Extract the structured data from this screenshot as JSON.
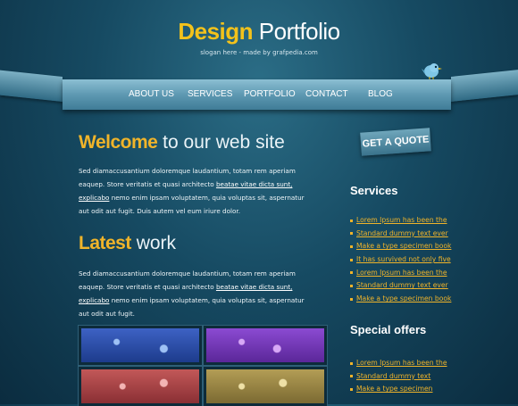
{
  "header": {
    "logo_part1": "Design",
    "logo_part2": "Portfolio",
    "slogan": "slogan here - made by grafpedia.com"
  },
  "nav": {
    "items": [
      {
        "label": "ABOUT US"
      },
      {
        "label": "SERVICES"
      },
      {
        "label": "PORTFOLIO"
      },
      {
        "label": "CONTACT"
      },
      {
        "label": "BLOG"
      }
    ]
  },
  "welcome": {
    "title_accent": "Welcome",
    "title_rest": "to our web site",
    "text_before": "Sed diamaccusantium doloremque laudantium, totam rem aperiam eaquep. Store veritatis et quasi architecto ",
    "link": "beatae vitae dicta sunt, explicabo",
    "text_after": " nemo enim ipsam voluptatem, quia voluptas sit, aspernatur aut odit aut fugit. Duis autem vel eum iriure dolor."
  },
  "latest": {
    "title_accent": "Latest",
    "title_rest": "work",
    "text_before": "Sed diamaccusantium doloremque laudantium, totam rem aperiam eaquep. Store veritatis et quasi architecto ",
    "link": "beatae vitae dicta sunt, explicabo",
    "text_after": " nemo enim ipsam voluptatem, quia voluptas sit, aspernatur aut odit aut fugit."
  },
  "sidebar": {
    "quote_button": "GET A QUOTE",
    "services_title": "Services",
    "services": [
      "Lorem Ipsum has been the",
      "Standard dummy text ever",
      "Make a type specimen book",
      "It has survived not only five",
      "Lorem Ipsum has been the",
      "Standard dummy text ever",
      "Make a type specimen book"
    ],
    "offers_title": "Special offers",
    "offers": [
      "Lorem Ipsum has been the",
      "Standard dummy text",
      "Make a type specimen"
    ]
  },
  "colors": {
    "accent": "#f0b42a",
    "logo_yellow": "#f3c21b",
    "background": "#164a62",
    "nav": "#5e99b2"
  },
  "icons": {
    "mascot": "bird-icon",
    "bullet": "square-bullet-icon"
  }
}
